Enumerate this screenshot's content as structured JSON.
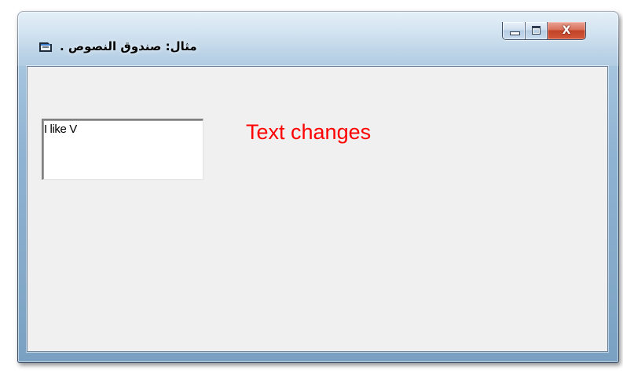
{
  "window": {
    "title": "مثال: صندوق النصوص .",
    "icon": "form-icon",
    "caption_buttons": {
      "minimize_icon": "minimize-icon",
      "maximize_icon": "maximize-icon",
      "close_label": "X"
    }
  },
  "form": {
    "textbox_value": "I like V",
    "label_text": "Text changes",
    "label_color": "#ff0000"
  }
}
